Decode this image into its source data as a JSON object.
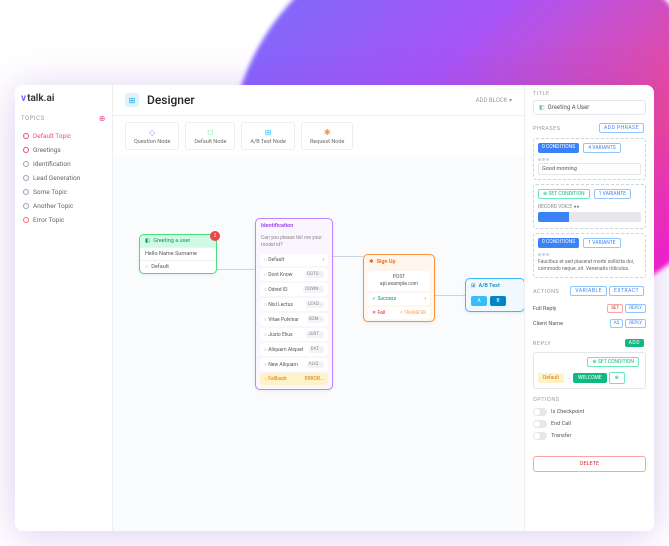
{
  "logo": {
    "brand": "talk.ai"
  },
  "sidebar": {
    "topics_label": "TOPICS",
    "items": [
      {
        "label": "Default Topic",
        "color": "#ec4899"
      },
      {
        "label": "Greetings",
        "color": "#ec4899"
      },
      {
        "label": "Identification",
        "color": "#94a3b8"
      },
      {
        "label": "Lead Generation",
        "color": "#94a3b8"
      },
      {
        "label": "Some Topic",
        "color": "#94a3b8"
      },
      {
        "label": "Another Topic",
        "color": "#94a3b8"
      },
      {
        "label": "Error Topic",
        "color": "#f87171"
      }
    ]
  },
  "header": {
    "title": "Designer",
    "add_block": "ADD BLOCK"
  },
  "toolbar": {
    "items": [
      {
        "label": "Question Node",
        "color": "#c084fc"
      },
      {
        "label": "Default Node",
        "color": "#4ade80"
      },
      {
        "label": "A/B Test Node",
        "color": "#38bdf8"
      },
      {
        "label": "Request Node",
        "color": "#fb923c"
      }
    ]
  },
  "nodes": {
    "green": {
      "title": "Greeting a user",
      "badge": "2",
      "body": "Hello Name Surname",
      "default": "Default"
    },
    "purple": {
      "title": "Identification",
      "subtitle": "Can you please tell me your model id?",
      "default": "Default",
      "options": [
        {
          "label": "Dont Know",
          "tag": "GOTO..."
        },
        {
          "label": "Odred ID",
          "tag": "DOWN..."
        },
        {
          "label": "Nisl Lectus",
          "tag": "LEAD..."
        },
        {
          "label": "Vitae Pulvinar",
          "tag": "SOM..."
        },
        {
          "label": "Justo Elius",
          "tag": "JUST..."
        },
        {
          "label": "Aliquam Aliquet",
          "tag": "DAT..."
        },
        {
          "label": "New Aliquam",
          "tag": "ALIQ..."
        }
      ],
      "fallback": "Fallback",
      "fallback_tag": "ERROR..."
    },
    "orange": {
      "title": "Sign Up",
      "method": "POST",
      "url": "api.example.com",
      "success": "Success",
      "fail": "Fail",
      "transfer": "TRANSFER"
    },
    "blue": {
      "title": "A/B Test",
      "a": "A",
      "b": "B"
    }
  },
  "panel": {
    "title_label": "TITLE",
    "title_value": "Greeting A User",
    "phrases_label": "PHRASES",
    "add_phrase": "ADD PHRASE",
    "conditions": "0 CONDITIONS",
    "variants": "4 VARIANTS",
    "variants1": "1 VARIANTE",
    "phrase_text": "Good morning",
    "set_condition": "SET CONDITION",
    "record_voice": "RECORD VOICE",
    "lorem": "Faucibus et sed placerat morbi sollicita dui, commodo neque, sit. Venenatis ridiculus.",
    "actions_label": "ACTIONS",
    "variable": "VARIABLE",
    "extract": "EXTRACT",
    "action1": "Full Reply",
    "action2": "Client Name",
    "set": "SET",
    "reply": "REPLY",
    "as": "AS",
    "reply_label": "REPLY",
    "add": "ADD",
    "default": "Default",
    "welcome": "WELCOME",
    "options_label": "OPTIONS",
    "opt1": "Is Checkpoint",
    "opt2": "End Call",
    "opt3": "Transfer",
    "delete": "DELETE"
  }
}
